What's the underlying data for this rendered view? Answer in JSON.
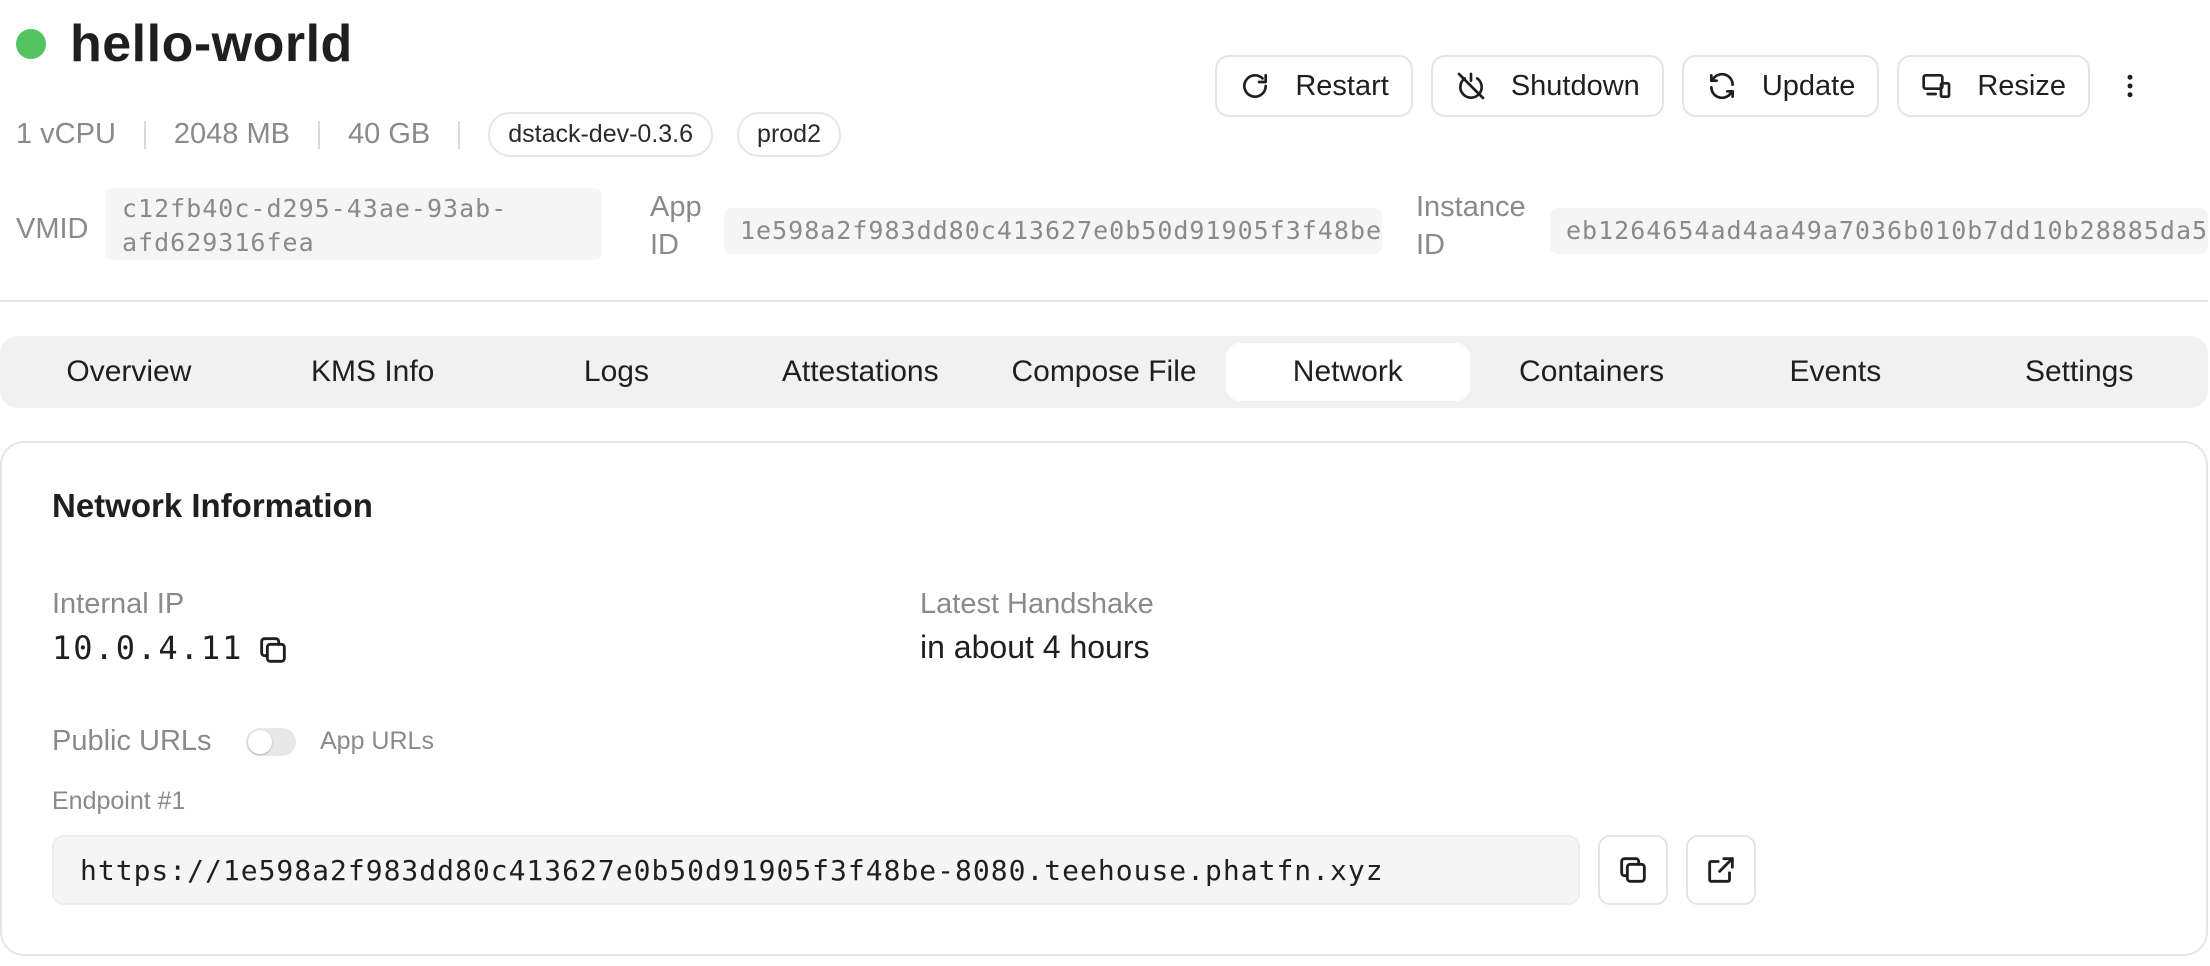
{
  "header": {
    "title": "hello-world",
    "status_color": "#53c45f",
    "specs": [
      "1 vCPU",
      "2048 MB",
      "40 GB"
    ],
    "tags": [
      "dstack-dev-0.3.6",
      "prod2"
    ],
    "ids": {
      "vmid_label": "VMID",
      "vmid_line1": "c12fb40c-d295-43ae-93ab-",
      "vmid_line2": "afd629316fea",
      "app_id_label_line1": "App",
      "app_id_label_line2": "ID",
      "app_id": "1e598a2f983dd80c413627e0b50d91905f3f48be",
      "instance_id_label_line1": "Instance",
      "instance_id_label_line2": "ID",
      "instance_id": "eb1264654ad4aa49a7036b010b7dd10b28885da5"
    },
    "actions": {
      "restart": "Restart",
      "shutdown": "Shutdown",
      "update": "Update",
      "resize": "Resize"
    }
  },
  "tabs": [
    {
      "label": "Overview"
    },
    {
      "label": "KMS Info"
    },
    {
      "label": "Logs"
    },
    {
      "label": "Attestations"
    },
    {
      "label": "Compose File"
    },
    {
      "label": "Network",
      "active": true
    },
    {
      "label": "Containers"
    },
    {
      "label": "Events"
    },
    {
      "label": "Settings"
    }
  ],
  "network": {
    "title": "Network Information",
    "internal_ip_label": "Internal IP",
    "internal_ip": "10.0.4.11",
    "handshake_label": "Latest Handshake",
    "handshake_value": "in about 4 hours",
    "public_urls_label": "Public URLs",
    "toggle_label": "App URLs",
    "endpoint_label": "Endpoint #1",
    "endpoint_url": "https://1e598a2f983dd80c413627e0b50d91905f3f48be-8080.teehouse.phatfn.xyz"
  },
  "icons": {
    "restart": "restart-icon",
    "shutdown": "power-off-icon",
    "update": "refresh-icon",
    "resize": "resize-icon",
    "more": "more-vertical-icon",
    "copy": "copy-icon",
    "external": "external-link-icon"
  }
}
